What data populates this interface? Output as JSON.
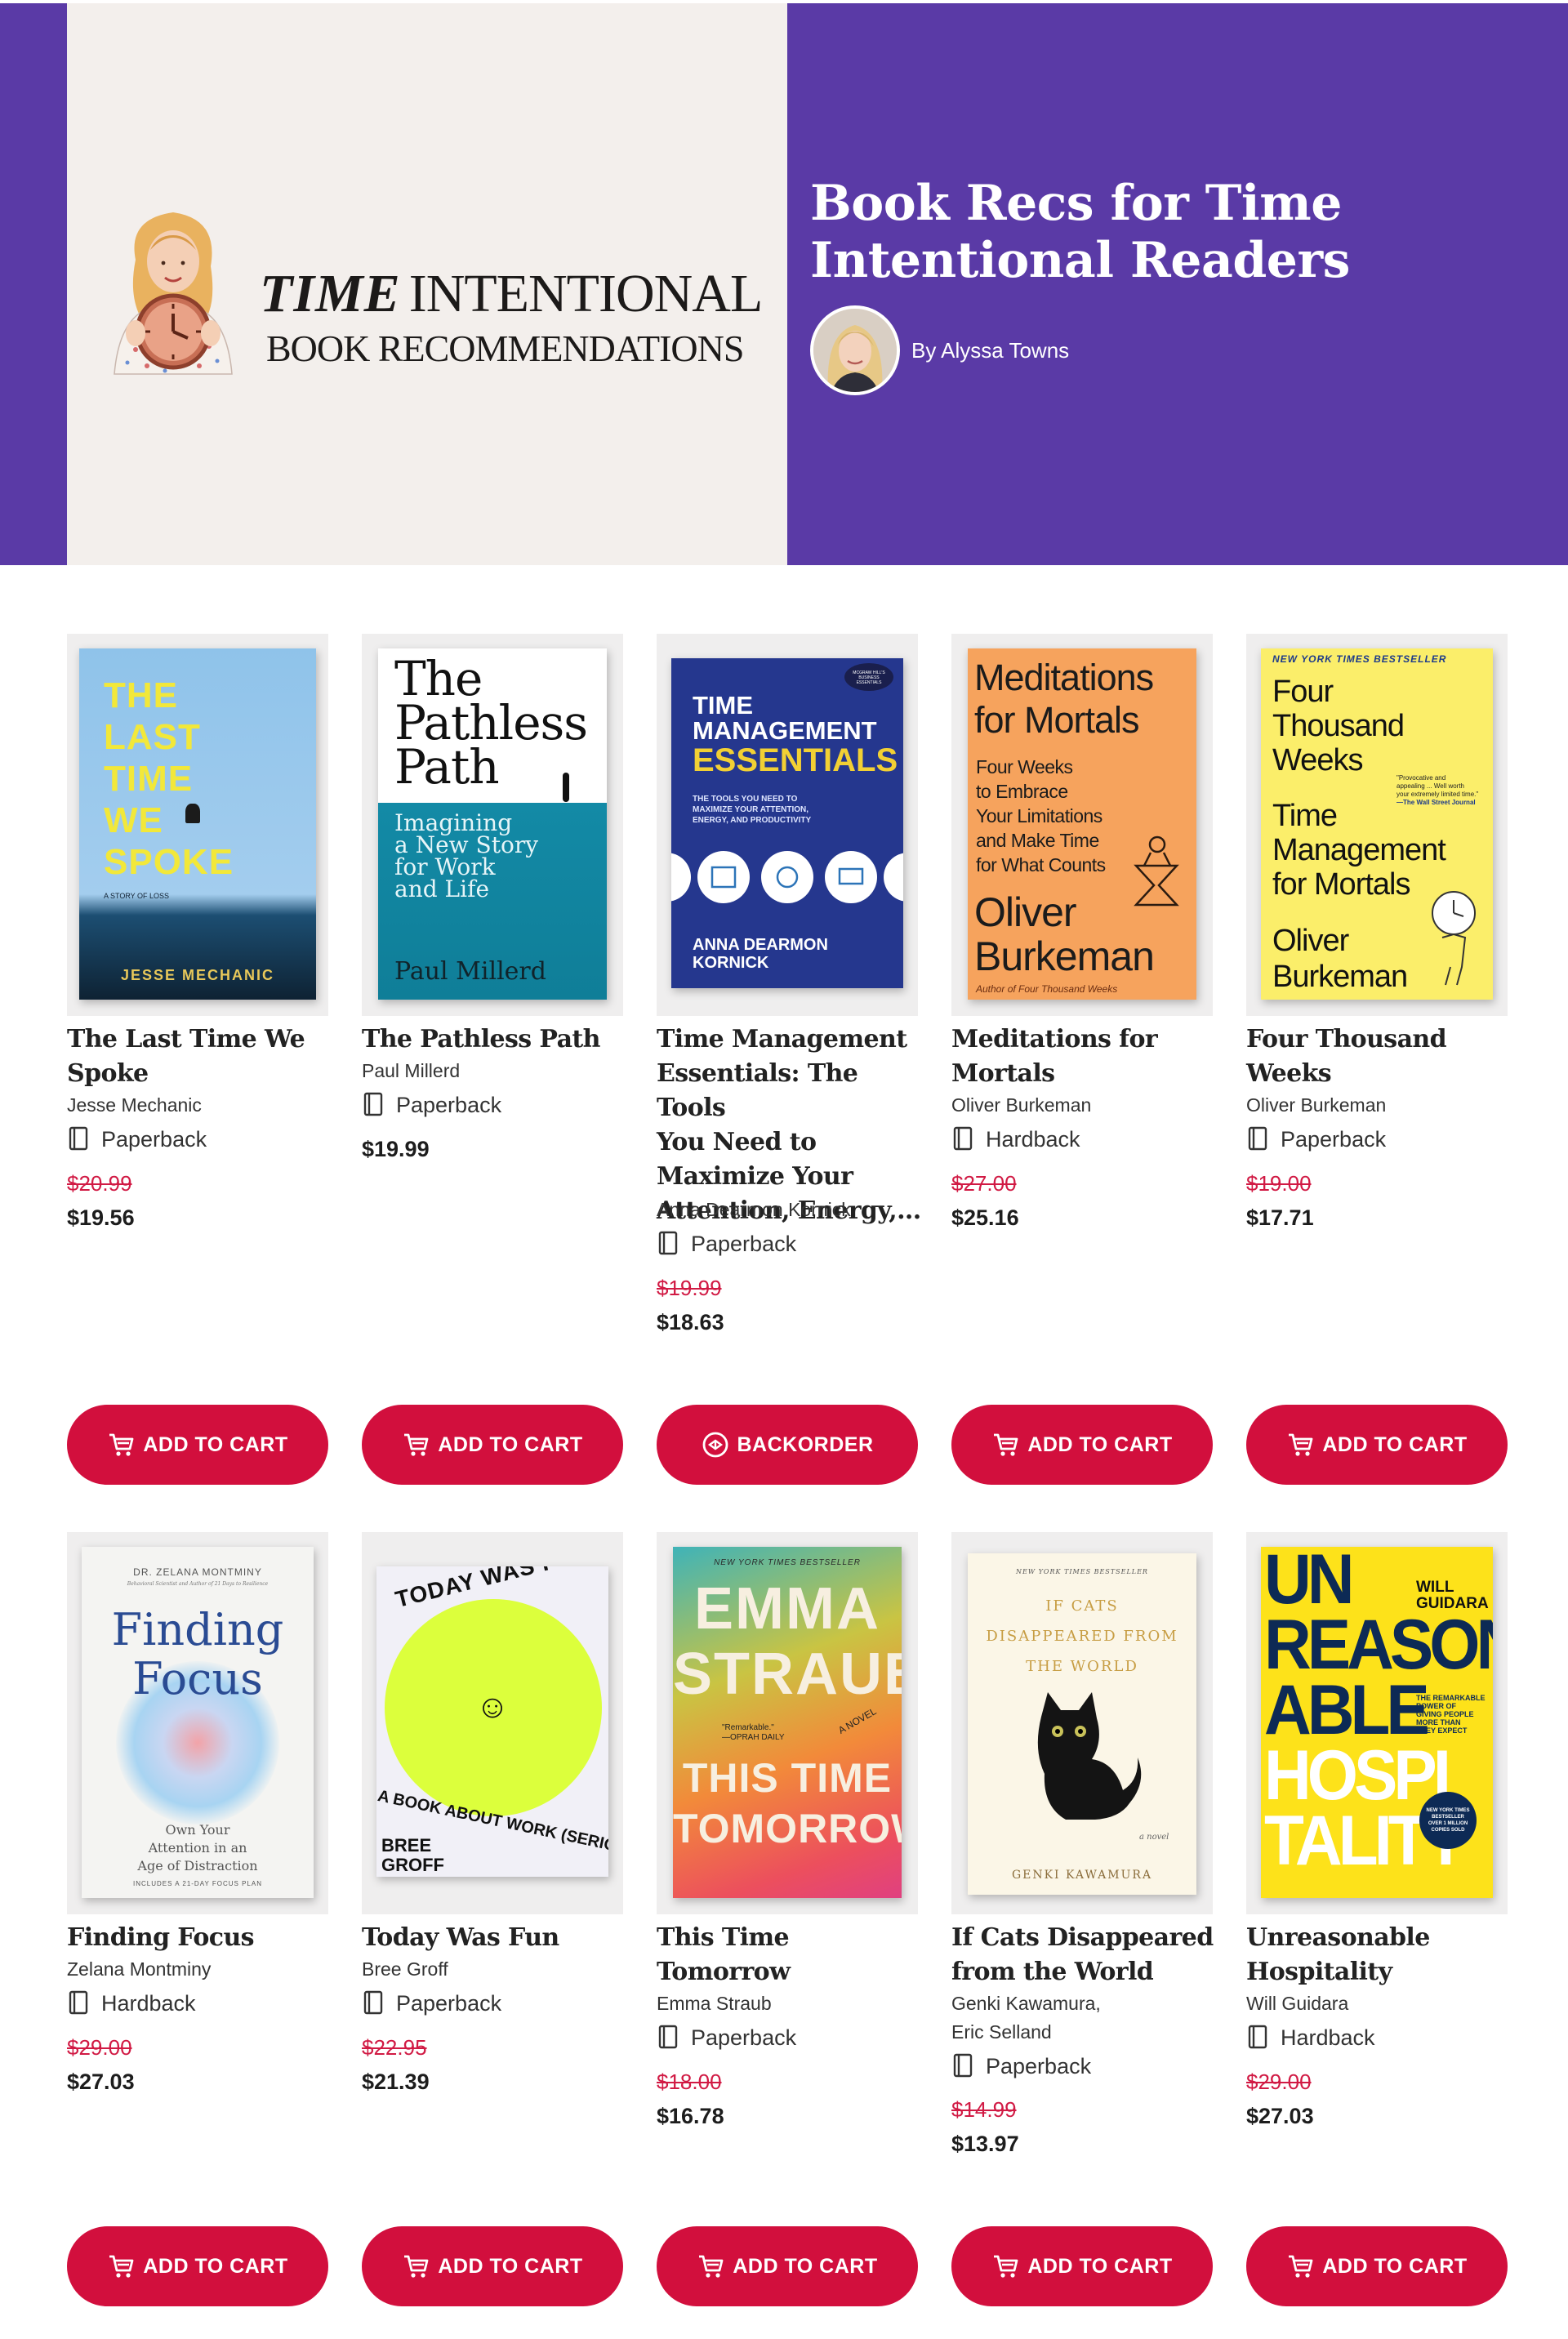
{
  "hero": {
    "brand_time": "TIME",
    "brand_intentional": "INTENTIONAL",
    "brand_sub": "BOOK RECOMMENDATIONS",
    "title": "Book Recs for Time Intentional Readers",
    "author": "By Alyssa Towns",
    "colors": {
      "purple": "#5a3aa6",
      "cream": "#f3efec"
    }
  },
  "books": [
    {
      "title_lines": [
        "The Last Time We",
        "Spoke"
      ],
      "author_lines": [
        "Jesse Mechanic"
      ],
      "format": "Paperback",
      "price_old": "$20.99",
      "price_new": "$19.56",
      "button": "ADD TO CART",
      "cover": {
        "lines": [
          "THE",
          "LAST",
          "TIME",
          "WE",
          "SPOKE"
        ],
        "tag": "A STORY OF LOSS",
        "author": "JESSE MECHANIC"
      }
    },
    {
      "title_lines": [
        "The Pathless Path"
      ],
      "author_lines": [
        "Paul Millerd"
      ],
      "format": "Paperback",
      "price_old": "",
      "price_new": "$19.99",
      "button": "ADD TO CART",
      "cover": {
        "lines": [
          "The",
          "Pathless",
          "Path"
        ],
        "sub": [
          "Imagining",
          "a New Story",
          "for Work",
          "and Life"
        ],
        "author": "Paul Millerd"
      }
    },
    {
      "title_lines": [
        "Time Management",
        "Essentials: The Tools",
        "You Need to",
        "Maximize Your",
        "Attention, Energy,..."
      ],
      "author_lines": [
        "Anna Dearmon Kornick"
      ],
      "format": "Paperback",
      "price_old": "$19.99",
      "price_new": "$18.63",
      "button": "BACKORDER",
      "cover": {
        "lines": [
          "TIME",
          "MANAGEMENT",
          "ESSENTIALS"
        ],
        "sub": [
          "THE TOOLS YOU NEED TO",
          "MAXIMIZE YOUR ATTENTION,",
          "ENERGY, AND PRODUCTIVITY"
        ],
        "badge": [
          "MCGRAW HILL'S",
          "BUSINESS",
          "ESSENTIALS"
        ],
        "author": [
          "ANNA DEARMON",
          "KORNICK"
        ]
      }
    },
    {
      "title_lines": [
        "Meditations for",
        "Mortals"
      ],
      "author_lines": [
        "Oliver Burkeman"
      ],
      "format": "Hardback",
      "price_old": "$27.00",
      "price_new": "$25.16",
      "button": "ADD TO CART",
      "cover": {
        "lines": [
          "Meditations",
          "for Mortals"
        ],
        "sub": [
          "Four Weeks",
          "to Embrace",
          "Your Limitations",
          "and Make Time",
          "for What Counts"
        ],
        "author": [
          "Oliver",
          "Burkeman"
        ],
        "foot": "Author of Four Thousand Weeks"
      }
    },
    {
      "title_lines": [
        "Four Thousand",
        "Weeks"
      ],
      "author_lines": [
        "Oliver Burkeman"
      ],
      "format": "Paperback",
      "price_old": "$19.00",
      "price_new": "$17.71",
      "button": "ADD TO CART",
      "cover": {
        "badge": "NEW YORK TIMES BESTSELLER",
        "lines": [
          "Four",
          "Thousand",
          "Weeks"
        ],
        "sub": [
          "Time",
          "Management",
          "for Mortals"
        ],
        "quote": [
          "\"Provocative and",
          "appealing ... Well worth",
          "your extremely limited time.\"",
          "—The Wall Street Journal"
        ],
        "author": [
          "Oliver",
          "Burkeman"
        ]
      }
    },
    {
      "title_lines": [
        "Finding Focus"
      ],
      "author_lines": [
        "Zelana Montminy"
      ],
      "format": "Hardback",
      "price_old": "$29.00",
      "price_new": "$27.03",
      "button": "ADD TO CART",
      "cover": {
        "top": "DR. ZELANA MONTMINY",
        "top2": "Behavioral Scientist and Author of 21 Days to Resilience",
        "lines": [
          "Finding",
          "Focus"
        ],
        "sub": [
          "Own Your",
          "Attention in an",
          "Age of Distraction"
        ],
        "foot": "INCLUDES A 21-DAY FOCUS PLAN"
      }
    },
    {
      "title_lines": [
        "Today Was Fun"
      ],
      "author_lines": [
        "Bree Groff"
      ],
      "format": "Paperback",
      "price_old": "$22.95",
      "price_new": "$21.39",
      "button": "ADD TO CART",
      "cover": {
        "top": "TODAY WAS FUN",
        "bottom": "A BOOK ABOUT WORK (SERIOUSLY)",
        "author": [
          "BREE",
          "GROFF"
        ],
        "smile": "☺"
      }
    },
    {
      "title_lines": [
        "This Time",
        "Tomorrow"
      ],
      "author_lines": [
        "Emma Straub"
      ],
      "format": "Paperback",
      "price_old": "$18.00",
      "price_new": "$16.78",
      "button": "ADD TO CART",
      "cover": {
        "badge": "NEW YORK TIMES BESTSELLER",
        "author": [
          "EMMA",
          "STRAUB"
        ],
        "quote": [
          "\"Remarkable.\"",
          "—OPRAH DAILY"
        ],
        "novel": "A NOVEL",
        "lines": [
          "THIS TIME",
          "TOMORROW"
        ]
      }
    },
    {
      "title_lines": [
        "If Cats Disappeared",
        "from the World"
      ],
      "author_lines": [
        "Genki Kawamura,",
        "Eric Selland"
      ],
      "format": "Paperback",
      "price_old": "$14.99",
      "price_new": "$13.97",
      "button": "ADD TO CART",
      "cover": {
        "badge": "NEW YORK TIMES BESTSELLER",
        "lines": [
          "IF CATS",
          "DISAPPEARED FROM",
          "THE WORLD"
        ],
        "novel": "a novel",
        "author": "GENKI KAWAMURA"
      }
    },
    {
      "title_lines": [
        "Unreasonable",
        "Hospitality"
      ],
      "author_lines": [
        "Will Guidara"
      ],
      "format": "Hardback",
      "price_old": "$29.00",
      "price_new": "$27.03",
      "button": "ADD TO CART",
      "cover": {
        "author": [
          "WILL",
          "GUIDARA"
        ],
        "lines": [
          "UN",
          "REASON",
          "ABLE",
          "HOSPI",
          "TALITY"
        ],
        "sub": [
          "THE REMARKABLE",
          "POWER OF",
          "GIVING PEOPLE",
          "MORE THAN",
          "THEY EXPECT"
        ],
        "badge": [
          "NEW YORK TIMES",
          "BESTSELLER",
          "OVER 1 MILLION",
          "COPIES SOLD"
        ]
      }
    }
  ]
}
